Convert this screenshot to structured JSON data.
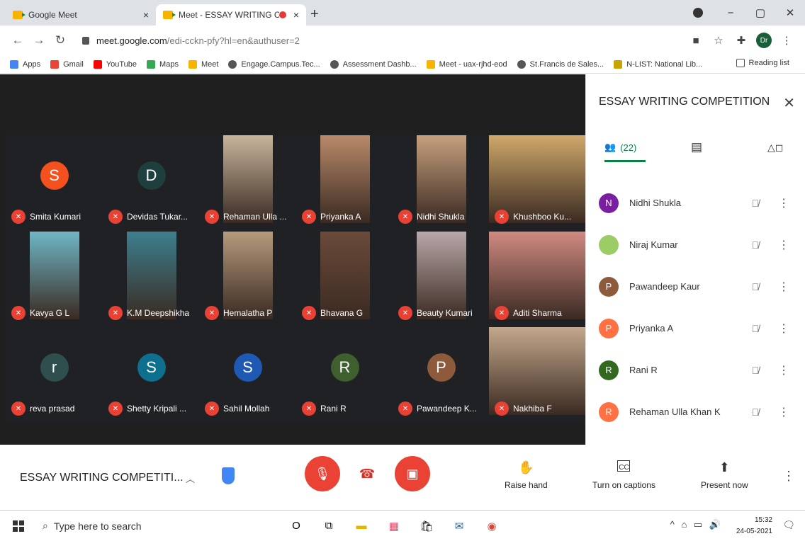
{
  "browser": {
    "tabs": [
      {
        "title": "Google Meet",
        "close": "×"
      },
      {
        "title": "Meet - ESSAY WRITING CO",
        "close": "×"
      }
    ],
    "new_tab": "+",
    "window": {
      "minimize": "−",
      "restore": "▢",
      "close": "✕"
    },
    "url_main": "meet.google.com",
    "url_rest": "/edi-cckn-pfy?hl=en&authuser=2",
    "profile_initials": "Dr",
    "bookmarks": [
      {
        "label": "Apps",
        "color": "#4285f4"
      },
      {
        "label": "Gmail",
        "color": "#ea4335"
      },
      {
        "label": "YouTube",
        "color": "#ff0000"
      },
      {
        "label": "Maps",
        "color": "#34a853"
      },
      {
        "label": "Meet",
        "color": "#f6b400"
      },
      {
        "label": "Engage.Campus.Tec...",
        "color": "#555555"
      },
      {
        "label": "Assessment Dashb...",
        "color": "#555555"
      },
      {
        "label": "Meet - uax-rjhd-eod",
        "color": "#f6b400"
      },
      {
        "label": "St.Francis de Sales...",
        "color": "#555555"
      },
      {
        "label": "N-LIST: National Lib...",
        "color": "#c8a400"
      }
    ],
    "reading_list": "Reading list"
  },
  "stage": {
    "tiles": [
      {
        "name": "Smita Kumari",
        "type": "avatar",
        "initial": "S",
        "color": "#f4511e"
      },
      {
        "name": "Devidas Tukar...",
        "type": "avatar",
        "initial": "D",
        "color": "#1f3f3f"
      },
      {
        "name": "Rehaman Ulla ...",
        "type": "video",
        "bg": "#c9b59c"
      },
      {
        "name": "Priyanka A",
        "type": "video",
        "bg": "#b98a6a"
      },
      {
        "name": "Nidhi Shukla",
        "type": "video",
        "bg": "#c7a07e"
      },
      {
        "name": "Khushboo Ku...",
        "type": "video",
        "bg": "#cfa86a"
      },
      {
        "name": "Kavya G L",
        "type": "video",
        "bg": "#6fb6c6"
      },
      {
        "name": "K.M Deepshikha",
        "type": "video",
        "bg": "#3d7f8e"
      },
      {
        "name": "Hemalatha P",
        "type": "video",
        "bg": "#b69a7c"
      },
      {
        "name": "Bhavana G",
        "type": "video",
        "bg": "#6b4a3a"
      },
      {
        "name": "Beauty Kumari",
        "type": "video",
        "bg": "#b9a8a8"
      },
      {
        "name": "Aditi Sharma",
        "type": "video",
        "bg": "#d08a82"
      },
      {
        "name": "reva prasad",
        "type": "avatar",
        "initial": "r",
        "color": "#2f4f4f"
      },
      {
        "name": "Shetty Kripali ...",
        "type": "avatar",
        "initial": "S",
        "color": "#0f6f8f"
      },
      {
        "name": "Sahil Mollah",
        "type": "avatar",
        "initial": "S",
        "color": "#1e5ab4"
      },
      {
        "name": "Rani R",
        "type": "avatar",
        "initial": "R",
        "color": "#3f5f2f"
      },
      {
        "name": "Pawandeep K...",
        "type": "avatar",
        "initial": "P",
        "color": "#8d5a3b"
      },
      {
        "name": "Nakhiba F",
        "type": "video",
        "bg": "#c4a88c"
      }
    ]
  },
  "panel": {
    "title": "ESSAY WRITING COMPETITION",
    "close": "✕",
    "people_count": "(22)",
    "participants": [
      {
        "name": "Nidhi Shukla",
        "initial": "N",
        "color": "#7b1fa2"
      },
      {
        "name": "Niraj Kumar",
        "initial": "",
        "color": "#9ccc65"
      },
      {
        "name": "Pawandeep Kaur",
        "initial": "P",
        "color": "#8d5a3b"
      },
      {
        "name": "Priyanka A",
        "initial": "P",
        "color": "#ff7043"
      },
      {
        "name": "Rani R",
        "initial": "R",
        "color": "#33691e"
      },
      {
        "name": "Rehaman Ulla Khan K",
        "initial": "R",
        "color": "#ff7043"
      }
    ]
  },
  "controls": {
    "meeting_name": "ESSAY WRITING COMPETITI...",
    "actions": [
      {
        "label": "Raise hand",
        "icon": "✋"
      },
      {
        "label": "Turn on captions",
        "icon": "CC"
      },
      {
        "label": "Present now",
        "icon": "⬆"
      }
    ]
  },
  "taskbar": {
    "search_placeholder": "Type here to search",
    "time": "15:32",
    "date": "24-05-2021"
  }
}
